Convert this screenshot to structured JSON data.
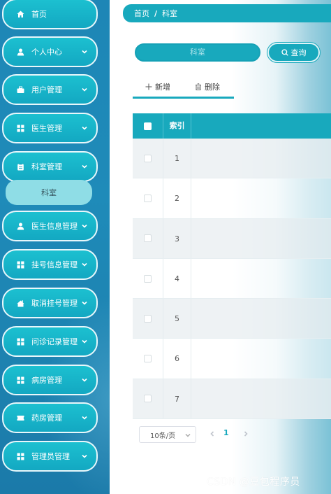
{
  "sidebar": {
    "items": [
      {
        "label": "首页",
        "icon": "home-icon",
        "has_arrow": false
      },
      {
        "label": "个人中心",
        "icon": "user-icon",
        "has_arrow": true
      },
      {
        "label": "用户管理",
        "icon": "briefcase-icon",
        "has_arrow": true
      },
      {
        "label": "医生管理",
        "icon": "grid-icon",
        "has_arrow": true
      },
      {
        "label": "科室管理",
        "icon": "clipboard-icon",
        "has_arrow": true
      },
      {
        "label": "医生信息管理",
        "icon": "user-icon",
        "has_arrow": true
      },
      {
        "label": "挂号信息管理",
        "icon": "grid-icon",
        "has_arrow": true
      },
      {
        "label": "取消挂号管理",
        "icon": "house-icon",
        "has_arrow": true
      },
      {
        "label": "问诊记录管理",
        "icon": "grid-icon",
        "has_arrow": true
      },
      {
        "label": "病房管理",
        "icon": "grid-icon",
        "has_arrow": true
      },
      {
        "label": "药房管理",
        "icon": "ticket-icon",
        "has_arrow": true
      },
      {
        "label": "管理员管理",
        "icon": "grid-icon",
        "has_arrow": true
      }
    ],
    "submenu": {
      "label": "科室"
    }
  },
  "breadcrumb": {
    "home": "首页",
    "separator": "/",
    "current": "科室"
  },
  "search": {
    "placeholder": "科室",
    "button_label": "查询"
  },
  "toolbar": {
    "add_label": "新增",
    "delete_label": "删除"
  },
  "table": {
    "header_index": "索引",
    "rows": [
      "1",
      "2",
      "3",
      "4",
      "5",
      "6",
      "7"
    ]
  },
  "pagination": {
    "page_size": "10条/页",
    "current_page": "1"
  },
  "watermark": "CSDN @豆包程序员",
  "colors": {
    "accent": "#18a9bd",
    "sidebar_bg": "#1e86b6",
    "submenu_bg": "#8fdde6"
  }
}
